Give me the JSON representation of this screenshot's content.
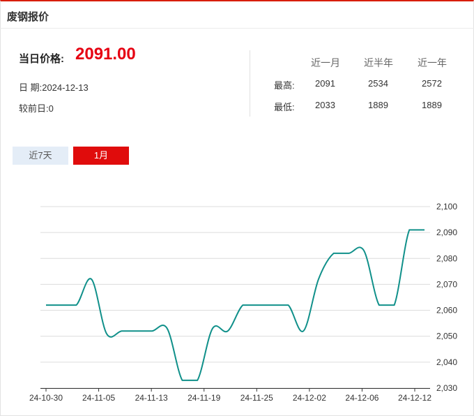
{
  "header": {
    "title": "废钢报价"
  },
  "summary": {
    "price_label": "当日价格:",
    "price_value": "2091.00",
    "date_text": "日 期:2024-12-13",
    "change_text": "较前日:0"
  },
  "stats": {
    "columns": [
      "近一月",
      "近半年",
      "近一年"
    ],
    "rows": [
      {
        "label": "最高:",
        "values": [
          "2091",
          "2534",
          "2572"
        ]
      },
      {
        "label": "最低:",
        "values": [
          "2033",
          "1889",
          "1889"
        ]
      }
    ]
  },
  "tabs": [
    {
      "label": "近7天",
      "active": false
    },
    {
      "label": "1月",
      "active": true
    }
  ],
  "colors": {
    "accent": "#e00c0c",
    "line": "#10908a",
    "price": "#e60012"
  },
  "chart_data": {
    "type": "line",
    "x_tick_labels": [
      "24-10-30",
      "24-11-05",
      "24-11-13",
      "24-11-19",
      "24-11-25",
      "24-12-02",
      "24-12-06",
      "24-12-12"
    ],
    "y_tick_labels": [
      "2,100",
      "2,090",
      "2,080",
      "2,070",
      "2,060",
      "2,050",
      "2,040",
      "2,030"
    ],
    "ylim": [
      2030,
      2100
    ],
    "grid": true,
    "series": [
      {
        "values": [
          2062,
          2062,
          2062,
          2072,
          2051,
          2052,
          2052,
          2052,
          2053,
          2033,
          2033,
          2053,
          2052,
          2062,
          2062,
          2062,
          2062,
          2052,
          2072,
          2082,
          2082,
          2083,
          2062,
          2062,
          2091,
          2091
        ]
      }
    ]
  }
}
